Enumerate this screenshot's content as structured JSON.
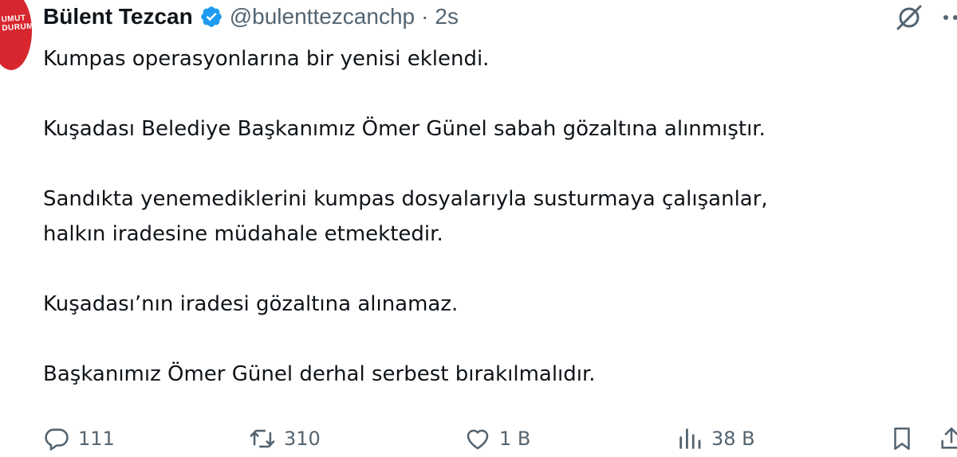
{
  "tweet": {
    "author": {
      "display_name": "Bülent Tezcan",
      "handle": "@bulenttezcanchp",
      "verified": true,
      "avatar_lettering": "UMUT DURUM",
      "avatar_color": "#d8262e"
    },
    "separator": "·",
    "time": "2s",
    "paragraphs": [
      [
        "Kumpas operasyonlarına bir yenisi eklendi."
      ],
      [
        "Kuşadası Belediye Başkanımız Ömer Günel sabah gözaltına alınmıştır."
      ],
      [
        "Sandıkta yenemediklerini kumpas dosyalarıyla susturmaya çalışanlar,",
        "halkın iradesine müdahale etmektedir."
      ],
      [
        "Kuşadası’nın iradesi gözaltına alınamaz."
      ],
      [
        "Başkanımız Ömer Günel derhal serbest bırakılmalıdır."
      ]
    ],
    "actions": {
      "replies": "111",
      "reposts": "310",
      "likes": "1 B",
      "views": "38 B"
    }
  },
  "icons": {
    "verified": "verified-badge-icon",
    "grok": "grok-icon",
    "more": "more-icon",
    "reply": "reply-icon",
    "repost": "repost-icon",
    "like": "heart-icon",
    "views": "views-icon",
    "bookmark": "bookmark-icon",
    "share": "share-icon"
  },
  "colors": {
    "text_primary": "#0f1419",
    "text_secondary": "#536471",
    "verified_blue": "#1d9bf0"
  }
}
